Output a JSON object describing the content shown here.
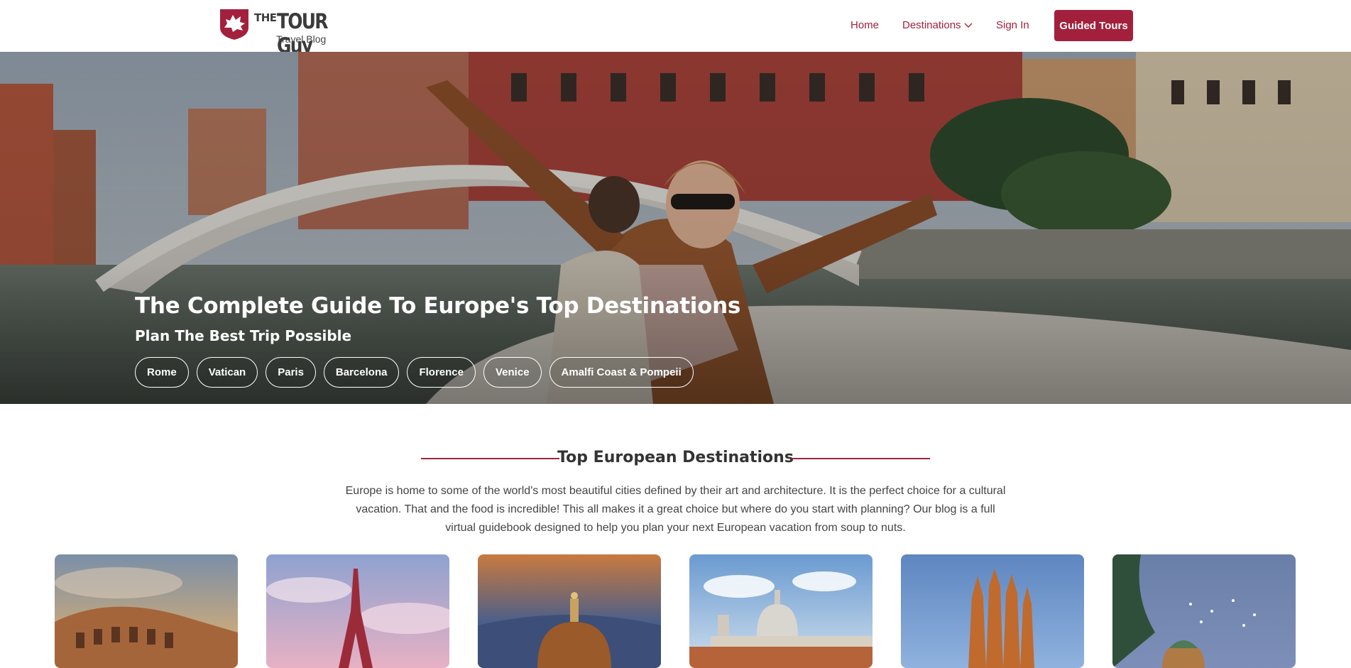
{
  "header": {
    "logo": {
      "the": "THE",
      "tour_guy": "TOUR Guy",
      "sub": "Travel Blog"
    },
    "nav": {
      "home": "Home",
      "destinations": "Destinations",
      "signin": "Sign In"
    },
    "cta": "Guided Tours"
  },
  "hero": {
    "title": "The Complete Guide To Europe's Top Destinations",
    "subtitle": "Plan The Best Trip Possible",
    "pills": [
      "Rome",
      "Vatican",
      "Paris",
      "Barcelona",
      "Florence",
      "Venice",
      "Amalfi Coast & Pompeii"
    ]
  },
  "section": {
    "title": "Top European Destinations",
    "description": "Europe is home to some of the world's most beautiful cities defined by their art and architecture. It is the perfect choice for a cultural vacation. That and the food is incredible! This all makes it a great choice but where do you start with planning? Our blog is a full virtual guidebook designed to help you plan your next European vacation from soup to nuts."
  },
  "cards": [
    {
      "icon": "colosseum-image"
    },
    {
      "icon": "eiffel-tower-image"
    },
    {
      "icon": "florence-duomo-image"
    },
    {
      "icon": "venice-basilica-image"
    },
    {
      "icon": "sagrada-familia-image"
    },
    {
      "icon": "amalfi-coast-image"
    }
  ],
  "colors": {
    "brand": "#a3203d"
  }
}
